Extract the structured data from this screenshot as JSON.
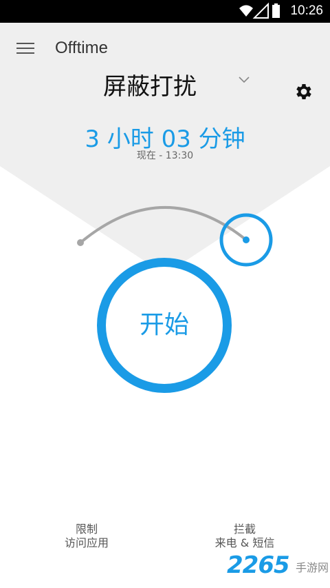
{
  "status_bar": {
    "time": "10:26"
  },
  "header": {
    "title": "Offtime"
  },
  "mode": {
    "selected": "屏蔽打扰"
  },
  "timer": {
    "duration": "3 小时 03 分钟",
    "now_line": "现在 - 13:30"
  },
  "start": {
    "label": "开始"
  },
  "bottom": {
    "left": {
      "line1": "限制",
      "line2": "访问应用"
    },
    "right": {
      "line1": "拦截",
      "line2": "来电 & 短信"
    }
  },
  "watermark": {
    "digits": "2265",
    "text": "手游网"
  },
  "colors": {
    "accent": "#1a9be6",
    "panel": "#efefef",
    "arc": "#a6a6a6"
  },
  "icons": [
    "menu-icon",
    "chevron-down-icon",
    "gear-icon",
    "wifi-icon",
    "signal-icon",
    "battery-icon"
  ]
}
